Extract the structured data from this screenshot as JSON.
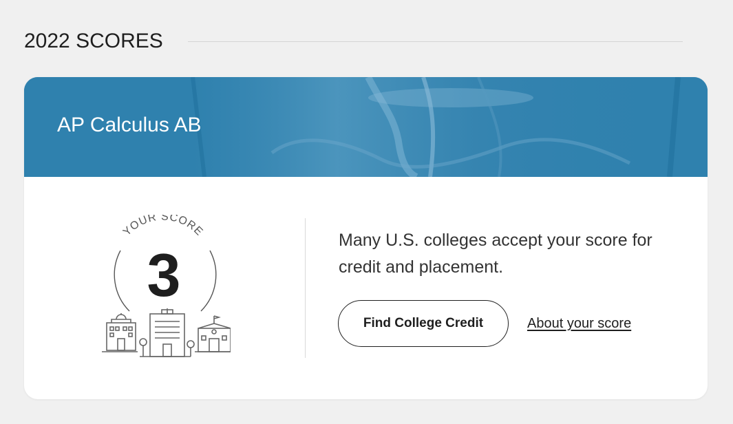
{
  "section": {
    "title": "2022 SCORES"
  },
  "card": {
    "exam_title": "AP Calculus AB",
    "score_caption": "YOUR SCORE",
    "score_value": "3",
    "message": "Many U.S. colleges accept your score for credit and placement.",
    "find_credit_label": "Find College Credit",
    "about_score_label": "About your score"
  },
  "colors": {
    "page_bg": "#f0f0f0",
    "banner_blue": "#2f81ae",
    "card_bg": "#ffffff",
    "text_dark": "#1e1e1e"
  },
  "icons": {
    "illustration": "college-buildings-icon"
  }
}
